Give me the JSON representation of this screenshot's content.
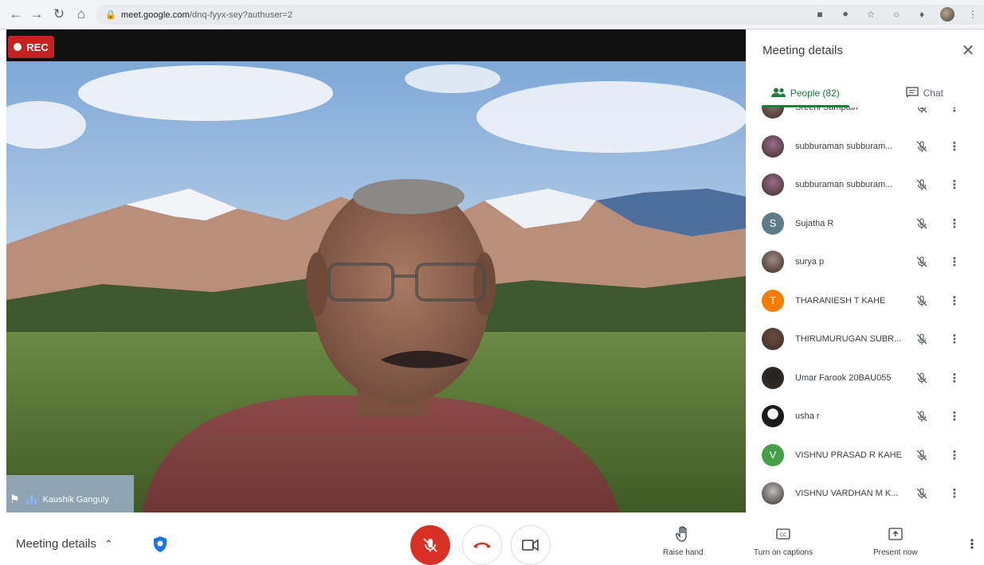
{
  "browser": {
    "url_host": "meet.google.com",
    "url_path": "/dnq-fyyx-sey?authuser=2"
  },
  "recording": {
    "label": "REC"
  },
  "video": {
    "speaker_name": "Kaushik Ganguly"
  },
  "panel": {
    "title": "Meeting details",
    "tabs": [
      {
        "label": "People (82)",
        "active": true,
        "icon": "people-icon"
      },
      {
        "label": "Chat",
        "active": false,
        "icon": "chat-icon"
      }
    ],
    "people": [
      {
        "name": "Sreeni Sampath",
        "avatar_type": "photo",
        "avatar_color": "#8d6e63",
        "initial": ""
      },
      {
        "name": "subburaman subburam...",
        "avatar_type": "photo",
        "avatar_color": "#9c6b8a",
        "initial": ""
      },
      {
        "name": "subburaman subburam...",
        "avatar_type": "photo",
        "avatar_color": "#9c6b8a",
        "initial": ""
      },
      {
        "name": "Sujatha R",
        "avatar_type": "initial",
        "avatar_color": "#5f7b8a",
        "initial": "S"
      },
      {
        "name": "surya p",
        "avatar_type": "photo",
        "avatar_color": "#a1887f",
        "initial": ""
      },
      {
        "name": "THARANIESH T KAHE",
        "avatar_type": "initial",
        "avatar_color": "#f57c00",
        "initial": "T"
      },
      {
        "name": "THIRUMURUGAN SUBR...",
        "avatar_type": "photo",
        "avatar_color": "#6d4c41",
        "initial": ""
      },
      {
        "name": "Umar Farook 20BAU055",
        "avatar_type": "photo",
        "avatar_color": "#212121",
        "initial": ""
      },
      {
        "name": "usha r",
        "avatar_type": "photo",
        "avatar_color": "#eeeeee",
        "initial": ""
      },
      {
        "name": "VISHNU PRASAD R KAHE",
        "avatar_type": "initial",
        "avatar_color": "#43a047",
        "initial": "V"
      },
      {
        "name": "VISHNU VARDHAN M K...",
        "avatar_type": "photo",
        "avatar_color": "#bdbdbd",
        "initial": ""
      }
    ]
  },
  "bottombar": {
    "meeting_details_label": "Meeting details",
    "raise_hand_label": "Raise hand",
    "captions_label": "Turn on captions",
    "present_label": "Present now"
  },
  "colors": {
    "accent_green": "#188038",
    "mic_off_red": "#d93025",
    "rec_red": "#c5221f",
    "shield_blue": "#1a73e8"
  }
}
